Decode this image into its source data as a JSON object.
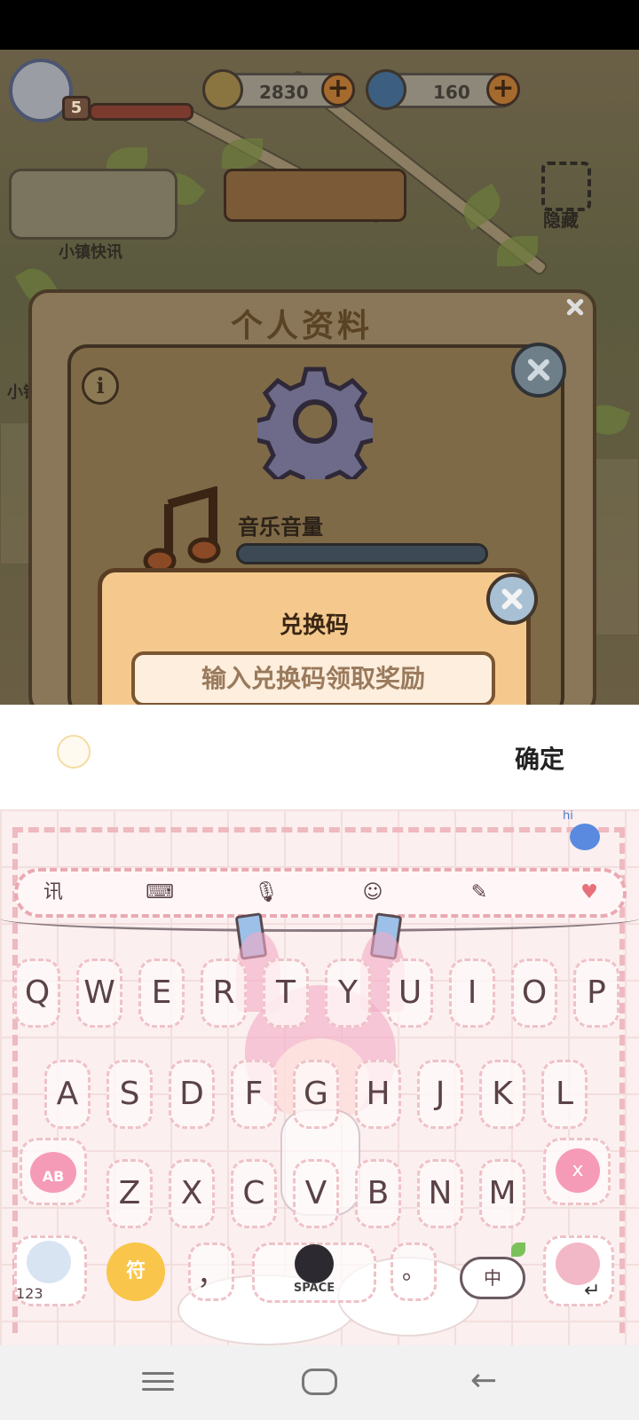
{
  "game": {
    "player_level": "5",
    "currency": [
      {
        "name": "coins",
        "value": "2830",
        "icon": "coin-icon",
        "color": "#a07b3a"
      },
      {
        "name": "gems",
        "value": "160",
        "icon": "swirl-gem-icon",
        "color": "#3c6c96"
      }
    ],
    "news_label": "小镇快讯",
    "side_label_partial": "小镇",
    "hide_label": "隐藏",
    "profile": {
      "title": "个人资料",
      "info_icon": "i",
      "music_label": "音乐音量"
    },
    "redeem": {
      "title": "兑换码",
      "placeholder": "输入兑换码领取奖励"
    }
  },
  "input_bar": {
    "confirm_label": "确定"
  },
  "keyboard": {
    "theme_color": "#fbefef",
    "toolbar": [
      {
        "label": "讯",
        "icon": "xun-logo-icon"
      },
      {
        "label": "⌨",
        "icon": "keyboard-icon"
      },
      {
        "label": "🎙",
        "icon": "microphone-icon"
      },
      {
        "label": "☺",
        "icon": "emoji-icon"
      },
      {
        "label": "✎",
        "icon": "clipboard-edit-icon"
      },
      {
        "label": "♥",
        "icon": "theme-heart-icon"
      }
    ],
    "row1": [
      "Q",
      "W",
      "E",
      "R",
      "T",
      "Y",
      "U",
      "I",
      "O",
      "P"
    ],
    "row2": [
      "A",
      "S",
      "D",
      "F",
      "G",
      "H",
      "J",
      "K",
      "L"
    ],
    "row3": [
      "Z",
      "X",
      "C",
      "V",
      "B",
      "N",
      "M"
    ],
    "shift_label": "AB",
    "delete_label": "x",
    "number_label": "123",
    "symbol_label": "符",
    "comma_label": "，",
    "space_label": "SPACE",
    "period_label": "。",
    "lang_label": "中",
    "enter_label": "↵",
    "hi_label": "hi"
  }
}
